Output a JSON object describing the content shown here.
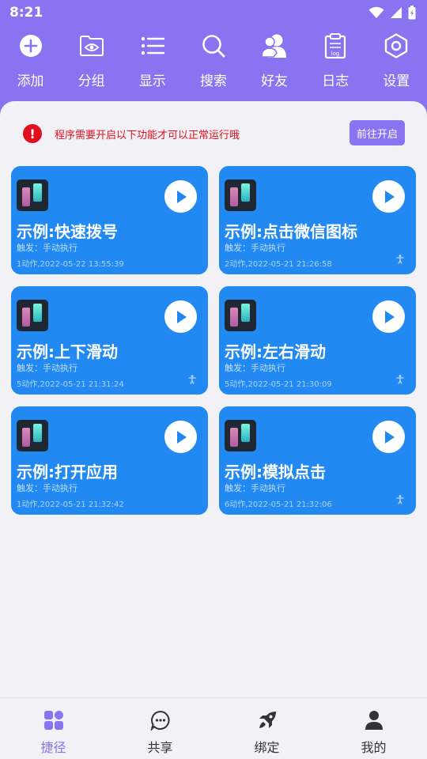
{
  "status_bar": {
    "time": "8:21"
  },
  "toolbar": [
    {
      "label": "添加",
      "icon": "plus-circle-icon"
    },
    {
      "label": "分组",
      "icon": "folder-eye-icon"
    },
    {
      "label": "显示",
      "icon": "list-icon"
    },
    {
      "label": "搜索",
      "icon": "search-icon"
    },
    {
      "label": "好友",
      "icon": "friends-icon"
    },
    {
      "label": "日志",
      "icon": "log-clipboard-icon"
    },
    {
      "label": "设置",
      "icon": "settings-hexagon-icon"
    }
  ],
  "notice": {
    "message": "程序需要开启以下功能才可以正常运行哦",
    "button": "前往开启",
    "icon": "exclamation-icon"
  },
  "cards": [
    {
      "title": "示例:快速拨号",
      "trigger": "触发：手动执行",
      "meta": "1动作,2022-05-22 13:55:39"
    },
    {
      "title": "示例:点击微信图标",
      "trigger": "触发：手动执行",
      "meta": "2动作,2022-05-21 21:26:58"
    },
    {
      "title": "示例:上下滑动",
      "trigger": "触发：手动执行",
      "meta": "5动作,2022-05-21 21:31:24"
    },
    {
      "title": "示例:左右滑动",
      "trigger": "触发：手动执行",
      "meta": "5动作,2022-05-21 21:30:09"
    },
    {
      "title": "示例:打开应用",
      "trigger": "触发：手动执行",
      "meta": "1动作,2022-05-21 21:32:42"
    },
    {
      "title": "示例:模拟点击",
      "trigger": "触发：手动执行",
      "meta": "6动作,2022-05-21 21:32:06"
    }
  ],
  "bottom_nav": [
    {
      "label": "捷径",
      "icon": "shortcut-grid-icon",
      "active": true
    },
    {
      "label": "共享",
      "icon": "chat-bubble-icon"
    },
    {
      "label": "绑定",
      "icon": "rocket-icon"
    },
    {
      "label": "我的",
      "icon": "person-icon"
    }
  ],
  "colors": {
    "accent": "#8a73f0",
    "card": "#2289f2",
    "background": "#f2f1f6",
    "warning": "#e0101f"
  }
}
